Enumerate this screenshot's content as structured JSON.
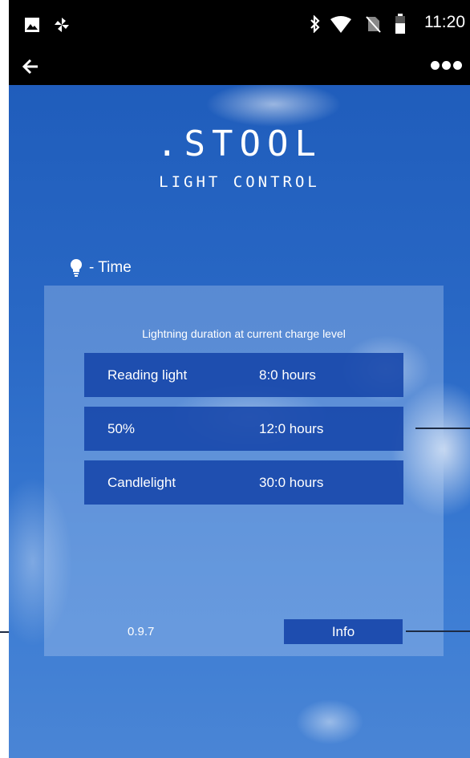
{
  "status_bar": {
    "time": "11:20",
    "left_icons": [
      "image-icon",
      "pinwheel-icon"
    ],
    "right_icons": [
      "bluetooth-icon",
      "wifi-icon",
      "no-sim-icon",
      "battery-icon"
    ]
  },
  "app_bar": {
    "back_icon": "arrow-left-icon",
    "menu_icon": "more-dots-icon"
  },
  "brand": {
    "title": ".STOOL",
    "subtitle": "LIGHT CONTROL"
  },
  "section": {
    "icon": "lightbulb-icon",
    "label": "- Time"
  },
  "panel": {
    "caption": "Lightning duration at current charge level",
    "rows": [
      {
        "name": "Reading light",
        "duration": "8:0 hours"
      },
      {
        "name": "50%",
        "duration": "12:0 hours"
      },
      {
        "name": "Candlelight",
        "duration": "30:0 hours"
      }
    ],
    "version": "0.9.7",
    "info_label": "Info"
  },
  "colors": {
    "sky_blue": "#2a69c6",
    "row_blue": "#1645aa",
    "bar_black": "#000000"
  }
}
